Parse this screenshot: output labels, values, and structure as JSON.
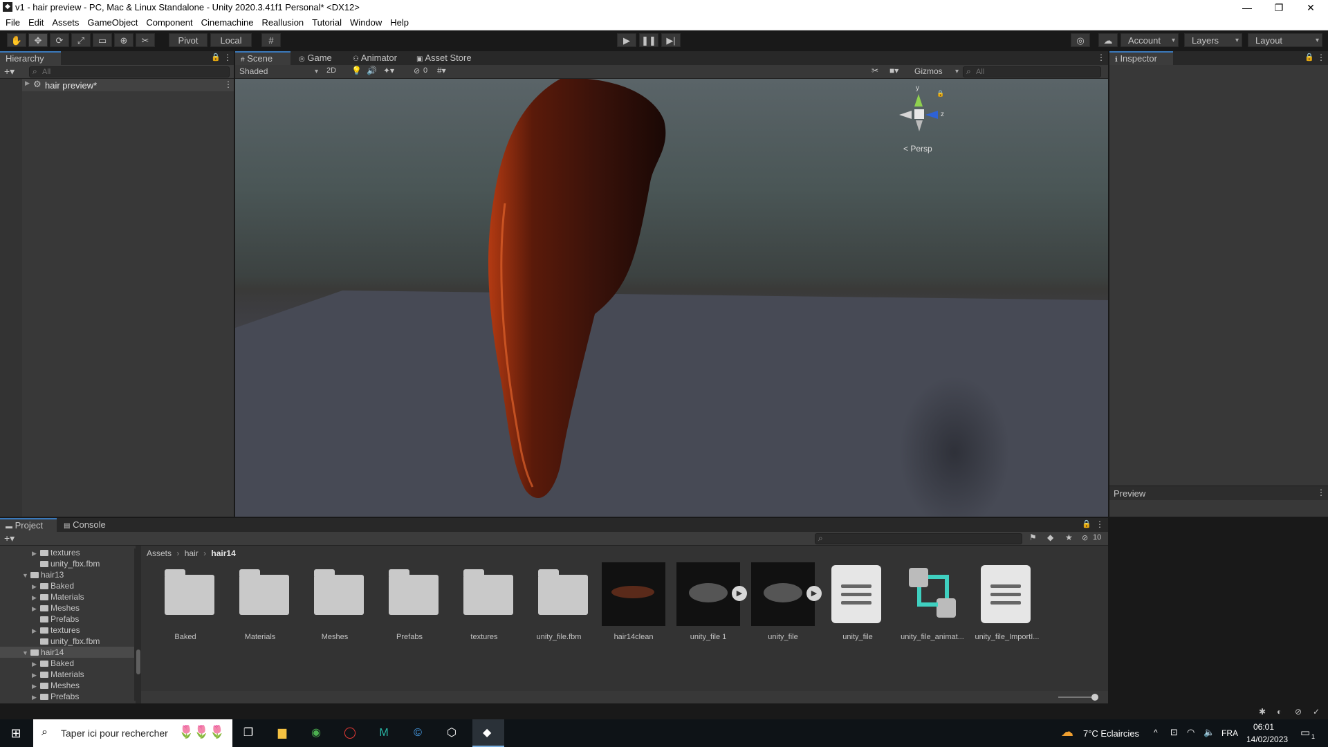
{
  "window": {
    "title": "v1 - hair preview - PC, Mac & Linux Standalone - Unity 2020.3.41f1 Personal* <DX12>",
    "controls": [
      "—",
      "❐",
      "✕"
    ]
  },
  "menu": [
    "File",
    "Edit",
    "Assets",
    "GameObject",
    "Component",
    "Cinemachine",
    "Reallusion",
    "Tutorial",
    "Window",
    "Help"
  ],
  "toolbar": {
    "pivot": "Pivot",
    "local": "Local",
    "account": "Account",
    "layers": "Layers",
    "layout": "Layout"
  },
  "hierarchy": {
    "tab": "Hierarchy",
    "search_placeholder": "All",
    "scene_item": "hair preview*"
  },
  "scene": {
    "tabs": [
      "Scene",
      "Game",
      "Animator",
      "Asset Store"
    ],
    "shading": "Shaded",
    "mode_2d": "2D",
    "hidden_count": "0",
    "gizmos": "Gizmos",
    "search_placeholder": "All",
    "axes": {
      "y": "y",
      "z": "z"
    },
    "projection": "< Persp"
  },
  "inspector": {
    "tab": "Inspector",
    "preview": "Preview"
  },
  "project": {
    "tabs": [
      "Project",
      "Console"
    ],
    "hidden_count": "10",
    "breadcrumb": [
      "Assets",
      "hair",
      "hair14"
    ],
    "tree": [
      {
        "label": "textures",
        "depth": 2,
        "arrow": "▶"
      },
      {
        "label": "unity_fbx.fbm",
        "depth": 2,
        "arrow": ""
      },
      {
        "label": "hair13",
        "depth": 1,
        "arrow": "▼"
      },
      {
        "label": "Baked",
        "depth": 2,
        "arrow": "▶"
      },
      {
        "label": "Materials",
        "depth": 2,
        "arrow": "▶"
      },
      {
        "label": "Meshes",
        "depth": 2,
        "arrow": "▶"
      },
      {
        "label": "Prefabs",
        "depth": 2,
        "arrow": ""
      },
      {
        "label": "textures",
        "depth": 2,
        "arrow": "▶"
      },
      {
        "label": "unity_fbx.fbm",
        "depth": 2,
        "arrow": ""
      },
      {
        "label": "hair14",
        "depth": 1,
        "arrow": "▼"
      },
      {
        "label": "Baked",
        "depth": 2,
        "arrow": "▶"
      },
      {
        "label": "Materials",
        "depth": 2,
        "arrow": "▶"
      },
      {
        "label": "Meshes",
        "depth": 2,
        "arrow": "▶"
      },
      {
        "label": "Prefabs",
        "depth": 2,
        "arrow": "▶"
      }
    ],
    "assets": [
      {
        "label": "Baked",
        "kind": "folder"
      },
      {
        "label": "Materials",
        "kind": "folder"
      },
      {
        "label": "Meshes",
        "kind": "folder"
      },
      {
        "label": "Prefabs",
        "kind": "folder"
      },
      {
        "label": "textures",
        "kind": "folder"
      },
      {
        "label": "unity_file.fbm",
        "kind": "folder"
      },
      {
        "label": "hair14clean",
        "kind": "thumb"
      },
      {
        "label": "unity_file 1",
        "kind": "thumb-play"
      },
      {
        "label": "unity_file",
        "kind": "thumb-play"
      },
      {
        "label": "unity_file",
        "kind": "doc"
      },
      {
        "label": "unity_file_animat...",
        "kind": "animator"
      },
      {
        "label": "unity_file_ImportI...",
        "kind": "doc"
      }
    ]
  },
  "taskbar": {
    "search_placeholder": "Taper ici pour rechercher",
    "weather": "7°C  Eclaircies",
    "lang": "FRA",
    "time": "06:01",
    "date": "14/02/2023",
    "notif_count": "1"
  }
}
